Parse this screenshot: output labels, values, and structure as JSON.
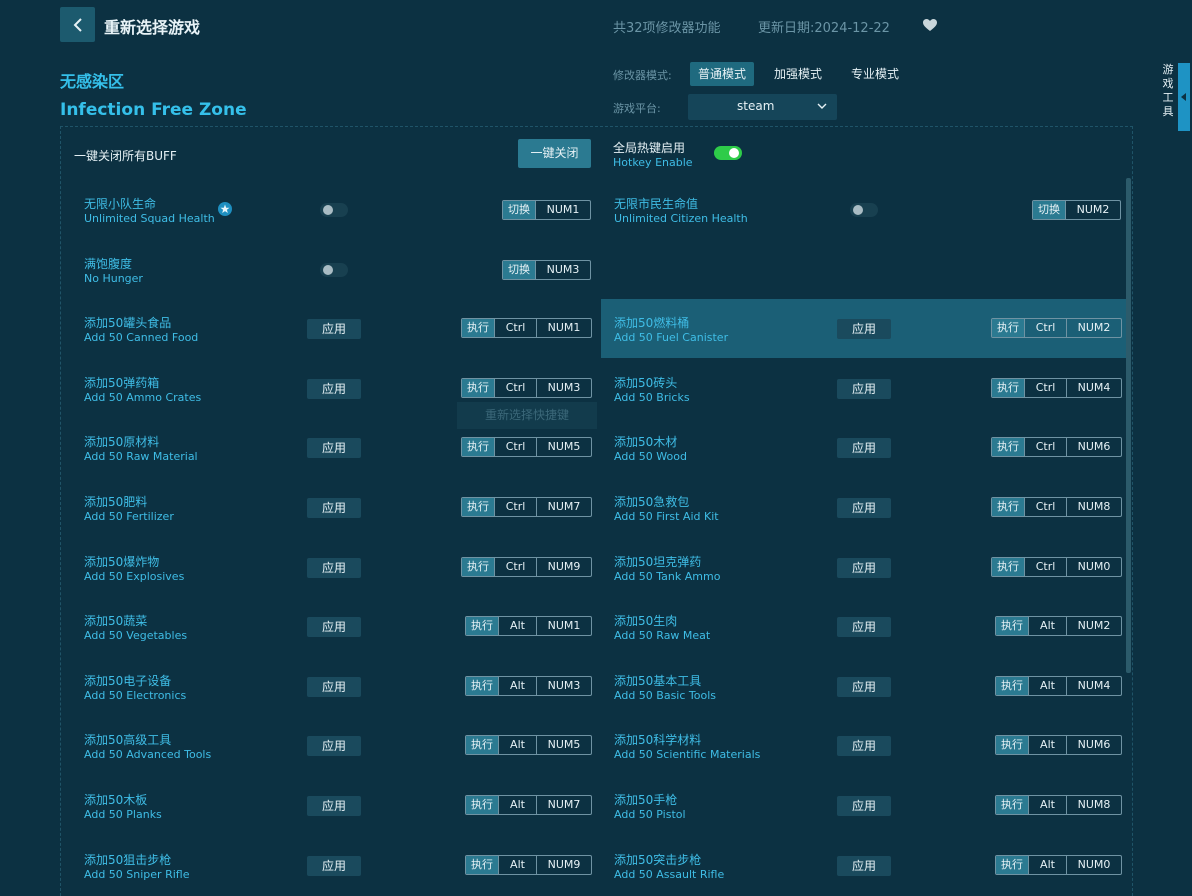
{
  "header": {
    "reselect_title": "重新选择游戏",
    "feature_count": "共32项修改器功能",
    "update_date": "更新日期:2024-12-22"
  },
  "game": {
    "title_cn": "无感染区",
    "title_en": "Infection Free Zone"
  },
  "mode": {
    "label": "修改器模式:",
    "options": [
      "普通模式",
      "加强模式",
      "专业模式"
    ],
    "active": "普通模式"
  },
  "platform": {
    "label": "游戏平台:",
    "value": "steam"
  },
  "side_tab": {
    "chars": [
      "游",
      "戏",
      "工",
      "具"
    ]
  },
  "buff": {
    "label": "一键关闭所有BUFF",
    "button": "一键关闭"
  },
  "hotkey": {
    "label_cn": "全局热键启用",
    "label_en": "Hotkey Enable",
    "enabled": true
  },
  "tooltip": "重新选择快捷键",
  "labels": {
    "apply": "应用",
    "execute": "执行",
    "switch": "切换"
  },
  "toggles": [
    {
      "cn": "无限小队生命",
      "en": "Unlimited Squad Health",
      "key": "NUM1",
      "starred": true,
      "enabled": false
    },
    {
      "cn": "无限市民生命值",
      "en": "Unlimited Citizen Health",
      "key": "NUM2",
      "starred": false,
      "enabled": false
    },
    {
      "cn": "满饱腹度",
      "en": "No Hunger",
      "key": "NUM3",
      "starred": false,
      "enabled": false
    }
  ],
  "items": [
    {
      "cn": "添加50罐头食品",
      "en": "Add 50 Canned Food",
      "mod": "Ctrl",
      "key": "NUM1"
    },
    {
      "cn": "添加50燃料桶",
      "en": "Add 50 Fuel Canister",
      "mod": "Ctrl",
      "key": "NUM2"
    },
    {
      "cn": "添加50弹药箱",
      "en": "Add 50 Ammo Crates",
      "mod": "Ctrl",
      "key": "NUM3"
    },
    {
      "cn": "添加50砖头",
      "en": "Add 50 Bricks",
      "mod": "Ctrl",
      "key": "NUM4"
    },
    {
      "cn": "添加50原材料",
      "en": "Add 50 Raw Material",
      "mod": "Ctrl",
      "key": "NUM5"
    },
    {
      "cn": "添加50木材",
      "en": "Add 50 Wood",
      "mod": "Ctrl",
      "key": "NUM6"
    },
    {
      "cn": "添加50肥料",
      "en": "Add 50 Fertilizer",
      "mod": "Ctrl",
      "key": "NUM7"
    },
    {
      "cn": "添加50急救包",
      "en": "Add 50 First Aid Kit",
      "mod": "Ctrl",
      "key": "NUM8"
    },
    {
      "cn": "添加50爆炸物",
      "en": "Add 50 Explosives",
      "mod": "Ctrl",
      "key": "NUM9"
    },
    {
      "cn": "添加50坦克弹药",
      "en": "Add 50 Tank Ammo",
      "mod": "Ctrl",
      "key": "NUM0"
    },
    {
      "cn": "添加50蔬菜",
      "en": "Add 50 Vegetables",
      "mod": "Alt",
      "key": "NUM1"
    },
    {
      "cn": "添加50生肉",
      "en": "Add 50 Raw Meat",
      "mod": "Alt",
      "key": "NUM2"
    },
    {
      "cn": "添加50电子设备",
      "en": "Add 50 Electronics",
      "mod": "Alt",
      "key": "NUM3"
    },
    {
      "cn": "添加50基本工具",
      "en": "Add 50 Basic Tools",
      "mod": "Alt",
      "key": "NUM4"
    },
    {
      "cn": "添加50高级工具",
      "en": "Add 50 Advanced Tools",
      "mod": "Alt",
      "key": "NUM5"
    },
    {
      "cn": "添加50科学材料",
      "en": "Add 50 Scientific Materials",
      "mod": "Alt",
      "key": "NUM6"
    },
    {
      "cn": "添加50木板",
      "en": "Add 50 Planks",
      "mod": "Alt",
      "key": "NUM7"
    },
    {
      "cn": "添加50手枪",
      "en": "Add 50 Pistol",
      "mod": "Alt",
      "key": "NUM8"
    },
    {
      "cn": "添加50狙击步枪",
      "en": "Add 50 Sniper Rifle",
      "mod": "Alt",
      "key": "NUM9"
    },
    {
      "cn": "添加50突击步枪",
      "en": "Add 50 Assault Rifle",
      "mod": "Alt",
      "key": "NUM0"
    }
  ]
}
